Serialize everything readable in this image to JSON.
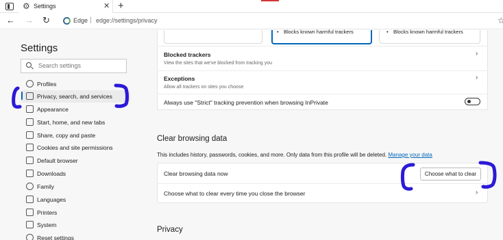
{
  "tab": {
    "title": "Settings",
    "close": "✕",
    "new_tab": "+"
  },
  "address": {
    "edge_label": "Edge",
    "separator": "|",
    "url": "edge://settings/privacy"
  },
  "sidebar": {
    "title": "Settings",
    "search_placeholder": "Search settings",
    "items": [
      {
        "label": "Profiles",
        "icon": "profile-icon"
      },
      {
        "label": "Privacy, search, and services",
        "icon": "lock-icon",
        "active": true
      },
      {
        "label": "Appearance",
        "icon": "appearance-icon"
      },
      {
        "label": "Start, home, and new tabs",
        "icon": "power-icon"
      },
      {
        "label": "Share, copy and paste",
        "icon": "share-icon"
      },
      {
        "label": "Cookies and site permissions",
        "icon": "cookie-icon"
      },
      {
        "label": "Default browser",
        "icon": "browser-icon"
      },
      {
        "label": "Downloads",
        "icon": "download-icon"
      },
      {
        "label": "Family",
        "icon": "family-icon"
      },
      {
        "label": "Languages",
        "icon": "language-icon"
      },
      {
        "label": "Printers",
        "icon": "printer-icon"
      },
      {
        "label": "System",
        "icon": "system-icon"
      },
      {
        "label": "Reset settings",
        "icon": "reset-icon"
      }
    ]
  },
  "tracking": {
    "cards": [
      {
        "bullet": "•",
        "text": ""
      },
      {
        "bullet": "•",
        "text": "Blocks known harmful trackers"
      },
      {
        "bullet": "•",
        "text": "Blocks known harmful trackers"
      }
    ],
    "blocked_trackers": {
      "title": "Blocked trackers",
      "subtitle": "View the sites that we've blocked from tracking you"
    },
    "exceptions": {
      "title": "Exceptions",
      "subtitle": "Allow all trackers on sites you choose"
    },
    "strict_inprivate": {
      "title": "Always use \"Strict\" tracking prevention when browsing InPrivate",
      "enabled": false
    }
  },
  "clear_data": {
    "title": "Clear browsing data",
    "description": "This includes history, passwords, cookies, and more. Only data from this profile will be deleted.",
    "manage_link": "Manage your data",
    "clear_now_label": "Clear browsing data now",
    "choose_button": "Choose what to clear",
    "on_close_label": "Choose what to clear every time you close the browser"
  },
  "privacy": {
    "title": "Privacy"
  },
  "colors": {
    "accent": "#0067b8",
    "annotation": "#2b1ad6"
  }
}
